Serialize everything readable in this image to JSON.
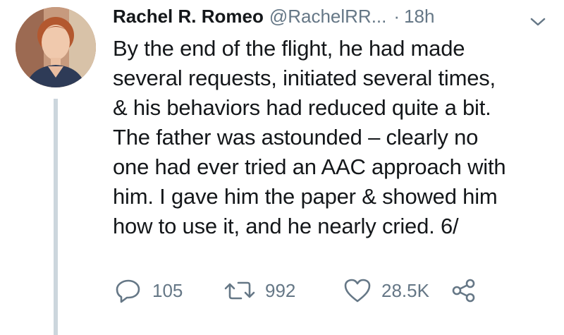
{
  "tweet": {
    "author_name": "Rachel R. Romeo",
    "author_handle": "@RachelRR...",
    "separator": "·",
    "timestamp": "18h",
    "text": "By the end of the flight, he had made\nseveral requests, initiated several times,\n& his behaviors had reduced quite a bit.\nThe father was astounded – clearly no\none had ever tried an AAC approach with\nhim. I gave him the paper & showed him\nhow to use it, and he nearly cried. 6/",
    "avatar_icon": "profile-photo",
    "menu_icon": "chevron-down-icon"
  },
  "actions": {
    "reply": {
      "icon": "reply-icon",
      "count": "105"
    },
    "retweet": {
      "icon": "retweet-icon",
      "count": "992"
    },
    "like": {
      "icon": "heart-icon",
      "count": "28.5K"
    },
    "share": {
      "icon": "share-icon"
    }
  },
  "colors": {
    "text": "#14171a",
    "secondary": "#657786",
    "thread_line": "#ccd6dd",
    "background": "#ffffff"
  }
}
